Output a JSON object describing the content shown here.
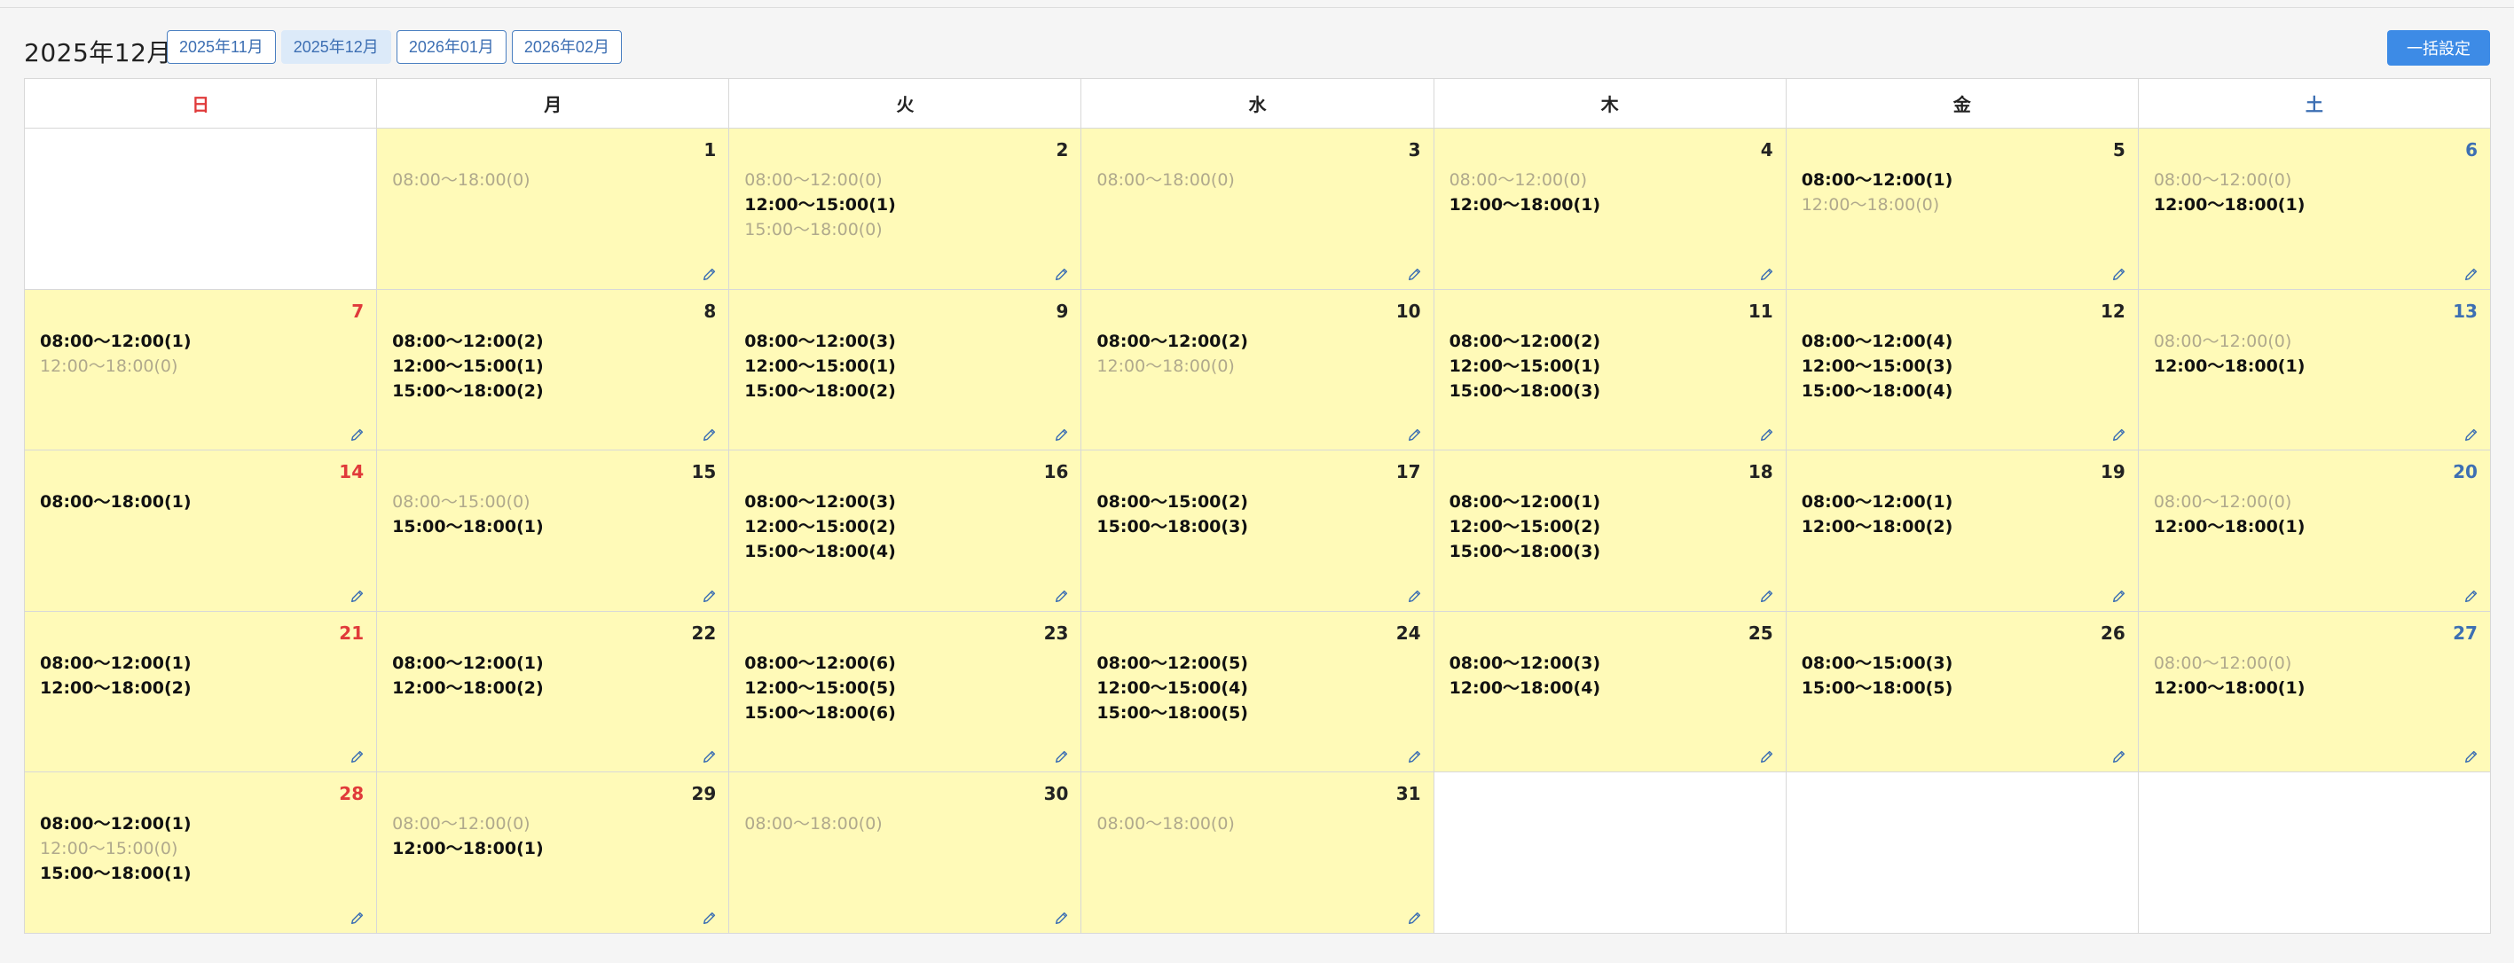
{
  "header": {
    "title": "2025年12月",
    "tabs": [
      "2025年11月",
      "2025年12月",
      "2026年01月",
      "2026年02月"
    ],
    "active_tab": 1,
    "bulk_button": "一括設定"
  },
  "weekdays": [
    "日",
    "月",
    "火",
    "水",
    "木",
    "金",
    "土"
  ],
  "colors": {
    "sunday": "#e03a3a",
    "saturday": "#3d6fb3",
    "cell_fill": "#fffab8",
    "accent": "#3d8be6"
  },
  "icons": {
    "edit": "pencil-icon"
  },
  "cells": [
    {
      "day": null
    },
    {
      "day": "1",
      "slots": [
        {
          "t": "08:00〜18:00(0)",
          "on": false
        }
      ]
    },
    {
      "day": "2",
      "slots": [
        {
          "t": "08:00〜12:00(0)",
          "on": false
        },
        {
          "t": "12:00〜15:00(1)",
          "on": true
        },
        {
          "t": "15:00〜18:00(0)",
          "on": false
        }
      ]
    },
    {
      "day": "3",
      "slots": [
        {
          "t": "08:00〜18:00(0)",
          "on": false
        }
      ]
    },
    {
      "day": "4",
      "slots": [
        {
          "t": "08:00〜12:00(0)",
          "on": false
        },
        {
          "t": "12:00〜18:00(1)",
          "on": true
        }
      ]
    },
    {
      "day": "5",
      "slots": [
        {
          "t": "08:00〜12:00(1)",
          "on": true
        },
        {
          "t": "12:00〜18:00(0)",
          "on": false
        }
      ]
    },
    {
      "day": "6",
      "slots": [
        {
          "t": "08:00〜12:00(0)",
          "on": false
        },
        {
          "t": "12:00〜18:00(1)",
          "on": true
        }
      ]
    },
    {
      "day": "7",
      "slots": [
        {
          "t": "08:00〜12:00(1)",
          "on": true
        },
        {
          "t": "12:00〜18:00(0)",
          "on": false
        }
      ]
    },
    {
      "day": "8",
      "slots": [
        {
          "t": "08:00〜12:00(2)",
          "on": true
        },
        {
          "t": "12:00〜15:00(1)",
          "on": true
        },
        {
          "t": "15:00〜18:00(2)",
          "on": true
        }
      ]
    },
    {
      "day": "9",
      "slots": [
        {
          "t": "08:00〜12:00(3)",
          "on": true
        },
        {
          "t": "12:00〜15:00(1)",
          "on": true
        },
        {
          "t": "15:00〜18:00(2)",
          "on": true
        }
      ]
    },
    {
      "day": "10",
      "slots": [
        {
          "t": "08:00〜12:00(2)",
          "on": true
        },
        {
          "t": "12:00〜18:00(0)",
          "on": false
        }
      ]
    },
    {
      "day": "11",
      "slots": [
        {
          "t": "08:00〜12:00(2)",
          "on": true
        },
        {
          "t": "12:00〜15:00(1)",
          "on": true
        },
        {
          "t": "15:00〜18:00(3)",
          "on": true
        }
      ]
    },
    {
      "day": "12",
      "slots": [
        {
          "t": "08:00〜12:00(4)",
          "on": true
        },
        {
          "t": "12:00〜15:00(3)",
          "on": true
        },
        {
          "t": "15:00〜18:00(4)",
          "on": true
        }
      ]
    },
    {
      "day": "13",
      "slots": [
        {
          "t": "08:00〜12:00(0)",
          "on": false
        },
        {
          "t": "12:00〜18:00(1)",
          "on": true
        }
      ]
    },
    {
      "day": "14",
      "slots": [
        {
          "t": "08:00〜18:00(1)",
          "on": true
        }
      ]
    },
    {
      "day": "15",
      "slots": [
        {
          "t": "08:00〜15:00(0)",
          "on": false
        },
        {
          "t": "15:00〜18:00(1)",
          "on": true
        }
      ]
    },
    {
      "day": "16",
      "slots": [
        {
          "t": "08:00〜12:00(3)",
          "on": true
        },
        {
          "t": "12:00〜15:00(2)",
          "on": true
        },
        {
          "t": "15:00〜18:00(4)",
          "on": true
        }
      ]
    },
    {
      "day": "17",
      "slots": [
        {
          "t": "08:00〜15:00(2)",
          "on": true
        },
        {
          "t": "15:00〜18:00(3)",
          "on": true
        }
      ]
    },
    {
      "day": "18",
      "slots": [
        {
          "t": "08:00〜12:00(1)",
          "on": true
        },
        {
          "t": "12:00〜15:00(2)",
          "on": true
        },
        {
          "t": "15:00〜18:00(3)",
          "on": true
        }
      ]
    },
    {
      "day": "19",
      "slots": [
        {
          "t": "08:00〜12:00(1)",
          "on": true
        },
        {
          "t": "12:00〜18:00(2)",
          "on": true
        }
      ]
    },
    {
      "day": "20",
      "slots": [
        {
          "t": "08:00〜12:00(0)",
          "on": false
        },
        {
          "t": "12:00〜18:00(1)",
          "on": true
        }
      ]
    },
    {
      "day": "21",
      "slots": [
        {
          "t": "08:00〜12:00(1)",
          "on": true
        },
        {
          "t": "12:00〜18:00(2)",
          "on": true
        }
      ]
    },
    {
      "day": "22",
      "slots": [
        {
          "t": "08:00〜12:00(1)",
          "on": true
        },
        {
          "t": "12:00〜18:00(2)",
          "on": true
        }
      ]
    },
    {
      "day": "23",
      "slots": [
        {
          "t": "08:00〜12:00(6)",
          "on": true
        },
        {
          "t": "12:00〜15:00(5)",
          "on": true
        },
        {
          "t": "15:00〜18:00(6)",
          "on": true
        }
      ]
    },
    {
      "day": "24",
      "slots": [
        {
          "t": "08:00〜12:00(5)",
          "on": true
        },
        {
          "t": "12:00〜15:00(4)",
          "on": true
        },
        {
          "t": "15:00〜18:00(5)",
          "on": true
        }
      ]
    },
    {
      "day": "25",
      "slots": [
        {
          "t": "08:00〜12:00(3)",
          "on": true
        },
        {
          "t": "12:00〜18:00(4)",
          "on": true
        }
      ]
    },
    {
      "day": "26",
      "slots": [
        {
          "t": "08:00〜15:00(3)",
          "on": true
        },
        {
          "t": "15:00〜18:00(5)",
          "on": true
        }
      ]
    },
    {
      "day": "27",
      "slots": [
        {
          "t": "08:00〜12:00(0)",
          "on": false
        },
        {
          "t": "12:00〜18:00(1)",
          "on": true
        }
      ]
    },
    {
      "day": "28",
      "slots": [
        {
          "t": "08:00〜12:00(1)",
          "on": true
        },
        {
          "t": "12:00〜15:00(0)",
          "on": false
        },
        {
          "t": "15:00〜18:00(1)",
          "on": true
        }
      ]
    },
    {
      "day": "29",
      "slots": [
        {
          "t": "08:00〜12:00(0)",
          "on": false
        },
        {
          "t": "12:00〜18:00(1)",
          "on": true
        }
      ]
    },
    {
      "day": "30",
      "slots": [
        {
          "t": "08:00〜18:00(0)",
          "on": false
        }
      ]
    },
    {
      "day": "31",
      "slots": [
        {
          "t": "08:00〜18:00(0)",
          "on": false
        }
      ]
    },
    {
      "day": null
    },
    {
      "day": null
    },
    {
      "day": null
    }
  ]
}
